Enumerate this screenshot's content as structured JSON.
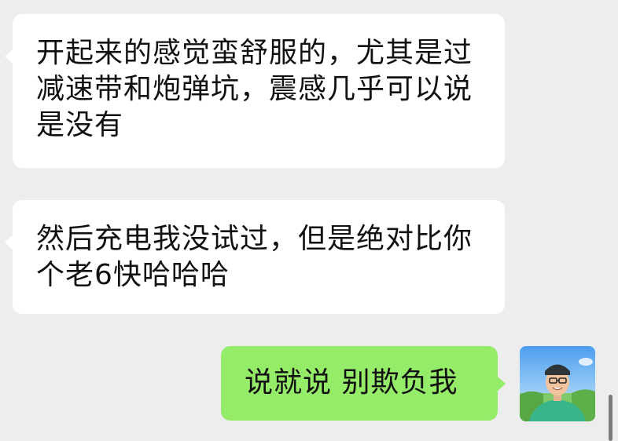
{
  "messages": [
    {
      "sender": "contact",
      "text": "开起来的感觉蛮舒服的，尤其是过减速带和炮弹坑，震感几乎可以说是没有"
    },
    {
      "sender": "contact",
      "text": "然后充电我没试过，但是绝对比你个老6快哈哈哈"
    },
    {
      "sender": "me",
      "text": "说就说 别欺负我"
    }
  ],
  "avatar": {
    "icon": "user-photo-avatar"
  },
  "colors": {
    "background": "#ededed",
    "incoming_bubble": "#ffffff",
    "outgoing_bubble": "#95ec69"
  }
}
